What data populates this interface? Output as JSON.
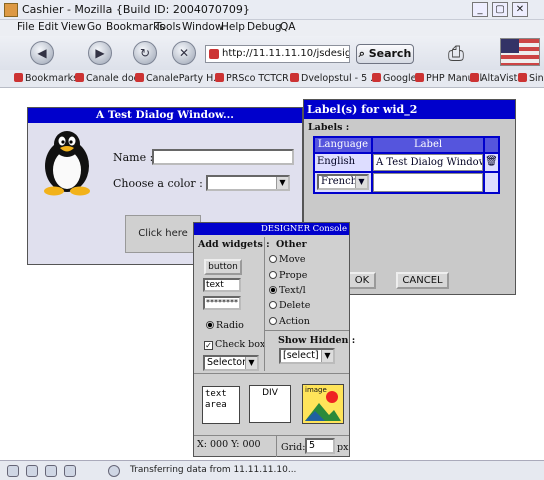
{
  "window": {
    "title": "Cashier - Mozilla {Build ID: 2004070709}",
    "controls": [
      "_",
      "▢",
      "✕"
    ]
  },
  "menu": [
    "File",
    "Edit",
    "View",
    "Go",
    "Bookmarks",
    "Tools",
    "Window",
    "Help",
    "Debug",
    "QA"
  ],
  "nav": {
    "url": "http://11.11.11.10/jsdesigne",
    "search_label": "Search"
  },
  "bookmarks": [
    "Bookmarks",
    "Canale doc",
    "CanaleParty H...",
    "PRSco TCTCR",
    "Dvelopstul - 5 ...",
    "Google",
    "PHP Manual",
    "AltaVista",
    "Sinus ..."
  ],
  "test_dialog": {
    "title": "A Test Dialog Window...",
    "name_label": "Name :",
    "color_label": "Choose a color :",
    "click_label": "Click here"
  },
  "label_dialog": {
    "title": "Label(s) for wid_2",
    "labels_heading": "Labels :",
    "columns": [
      "Language",
      "Label"
    ],
    "rows": [
      {
        "language": "English",
        "label": "A Test Dialog Window..."
      },
      {
        "language": "French",
        "label": ""
      }
    ],
    "ok_label": "OK",
    "cancel_label": "CANCEL"
  },
  "console": {
    "title": "DESIGNER Console",
    "add_widgets_heading": "Add widgets :",
    "button_label": "button",
    "text_value": "text",
    "password_value": "********",
    "radio_label": "Radio",
    "checkbox_label": "Check box",
    "selector_label": "Selector",
    "other_heading": "Other",
    "actions": [
      "Move",
      "Prope",
      "Text/l",
      "Delete",
      "Action"
    ],
    "show_hidden_heading": "Show Hidden :",
    "show_hidden_value": "[select]",
    "textarea_label": "text\narea",
    "div_label": "DIV",
    "image_label": "image",
    "coords": "X: 000 Y: 000",
    "grid_label": "Grid:",
    "grid_value": "5",
    "grid_unit": "px"
  },
  "status": {
    "text": "Transferring data from 11.11.11.10..."
  },
  "colors": {
    "dialog_title_bg": "#0000cc",
    "dialog_body_bg": "#e0e0ee"
  }
}
